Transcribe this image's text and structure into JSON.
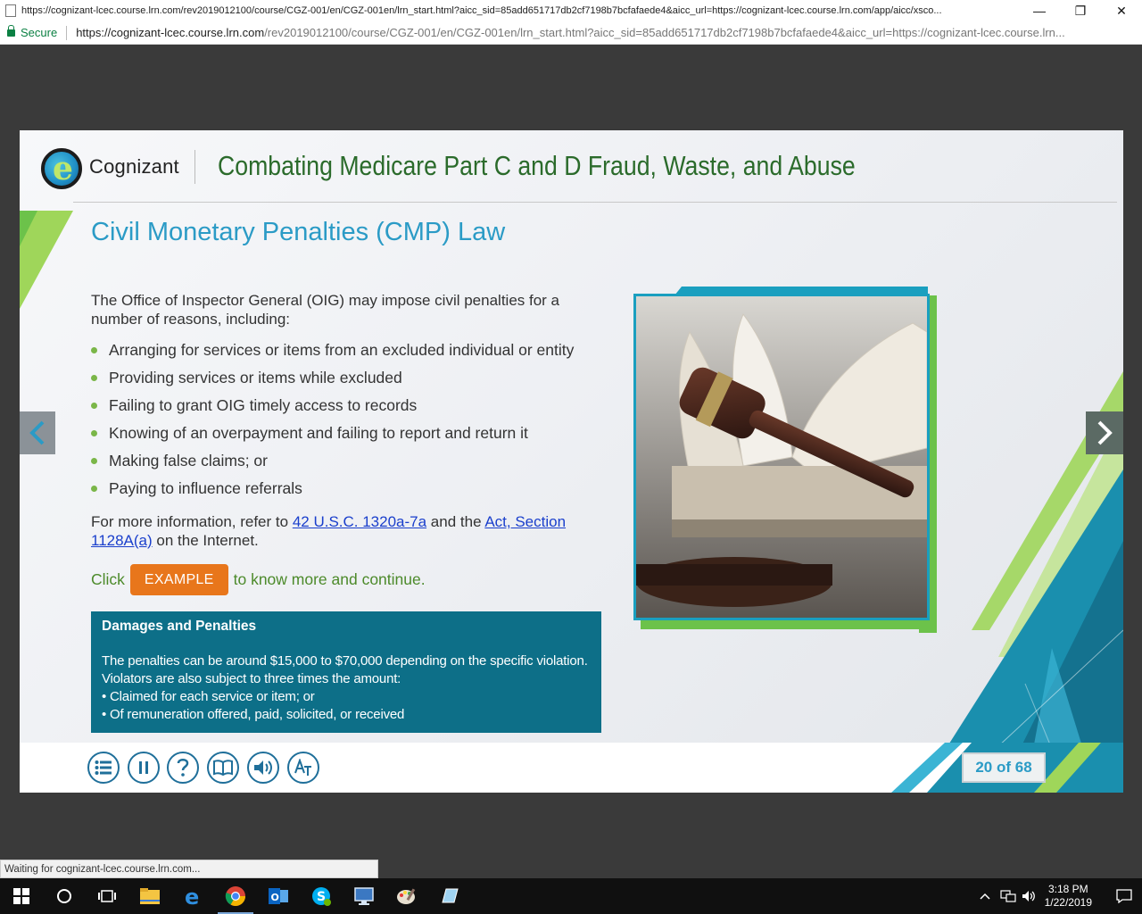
{
  "browser": {
    "window_title": "https://cognizant-lcec.course.lrn.com/rev2019012100/course/CGZ-001/en/CGZ-001en/lrn_start.html?aicc_sid=85add651717db2cf7198b7bcfafaede4&aicc_url=https://cognizant-lcec.course.lrn.com/app/aicc/xsco...",
    "secure_label": "Secure",
    "url_host": "https://cognizant-lcec.course.lrn.com",
    "url_path": "/rev2019012100/course/CGZ-001/en/CGZ-001en/lrn_start.html?aicc_sid=85add651717db2cf7198b7bcfafaede4&aicc_url=https://cognizant-lcec.course.lrn...",
    "minimize": "—",
    "restore": "❐",
    "close": "✕",
    "status_text": "Waiting for cognizant-lcec.course.lrn.com..."
  },
  "course": {
    "logo_text": "Cognizant",
    "course_title": "Combating Medicare Part C and D Fraud, Waste, and Abuse",
    "page_heading": "Civil Monetary Penalties (CMP) Law",
    "intro": "The Office of Inspector General (OIG) may impose civil penalties for a number of reasons, including:",
    "bullets": [
      "Arranging for services or items from an excluded individual or entity",
      "Providing services or items while excluded",
      "Failing to grant OIG timely access to records",
      "Knowing of an overpayment and failing to report and return it",
      "Making false claims; or",
      "Paying to influence referrals"
    ],
    "more_info": {
      "prefix": "For more information, refer to ",
      "link1": "42 U.S.C. 1320a-7a",
      "middle": " and the ",
      "link2": "Act, Section 1128A(a)",
      "suffix": " on the Internet."
    },
    "click_prefix": "Click",
    "example_label": "EXAMPLE",
    "click_suffix": "to know more and continue.",
    "damages": {
      "title": "Damages and Penalties",
      "body": "The penalties can be around $15,000 to $70,000 depending on the specific violation. Violators are also subject to three times the amount:",
      "items": [
        "Claimed for each service or item; or",
        "Of remuneration offered, paid, solicited, or received"
      ]
    },
    "page_counter": "20 of 68"
  },
  "taskbar": {
    "time": "3:18 PM",
    "date": "1/22/2019"
  },
  "colors": {
    "heading_blue": "#2b9bc6",
    "title_green": "#2b6b2b",
    "accent_green": "#7ab648",
    "example_orange": "#e8761b",
    "panel_teal": "#0d6f88",
    "toolbar_blue": "#1f6f9a"
  }
}
